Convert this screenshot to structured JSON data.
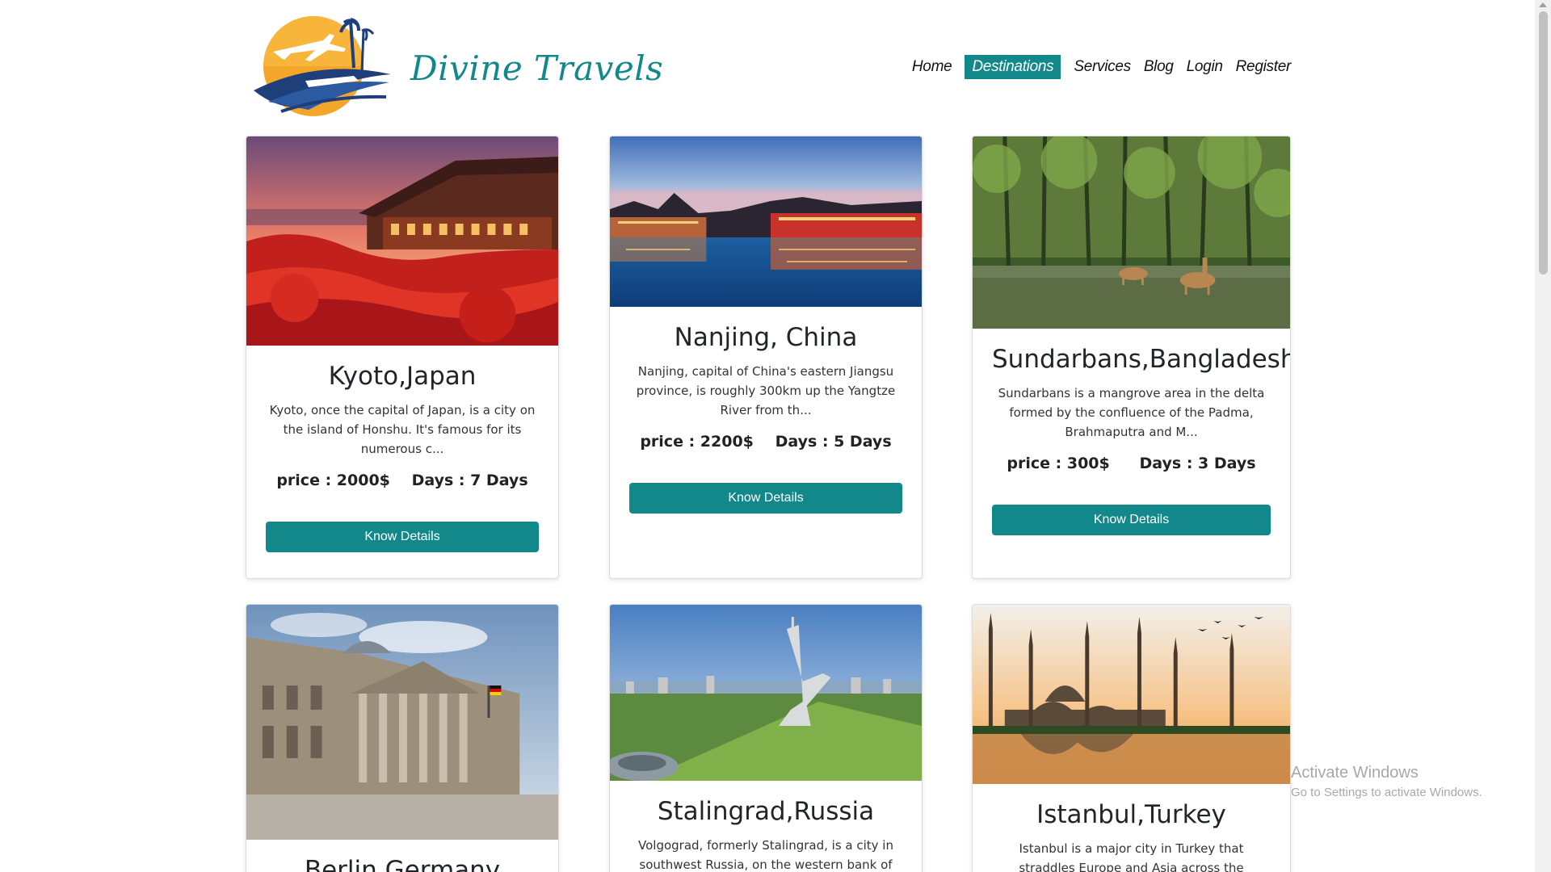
{
  "header": {
    "brand": "Divine Travels",
    "nav": [
      {
        "label": "Home",
        "active": false
      },
      {
        "label": "Destinations",
        "active": true
      },
      {
        "label": "Services",
        "active": false
      },
      {
        "label": "Blog",
        "active": false
      },
      {
        "label": "Login",
        "active": false
      },
      {
        "label": "Register",
        "active": false
      }
    ]
  },
  "destinations": [
    {
      "title": "Kyoto,Japan",
      "description": "Kyoto, once the capital of Japan, is a city on the island of Honshu. It's famous for its numerous c...",
      "price": "price : 2000$",
      "days": "Days : 7 Days",
      "button": "Know Details"
    },
    {
      "title": "Nanjing, China",
      "description": "Nanjing, capital of China's eastern Jiangsu province, is roughly 300km up the Yangtze River from th...",
      "price": "price : 2200$",
      "days": "Days : 5 Days",
      "button": "Know Details"
    },
    {
      "title": "Sundarbans,Bangladesh",
      "description": "Sundarbans is a mangrove area in the delta formed by the confluence of the Padma, Brahmaputra and M...",
      "price": "price : 300$",
      "days": "Days : 3 Days",
      "button": "Know Details"
    },
    {
      "title": "Berlin,Germany"
    },
    {
      "title": "Stalingrad,Russia",
      "description": "Volgograd, formerly Stalingrad, is a city in southwest Russia, on the western bank of the"
    },
    {
      "title": "Istanbul,Turkey",
      "description": "Istanbul is a major city in Turkey that straddles Europe and Asia across the Bosphorus Strait. Its"
    }
  ],
  "watermark": {
    "line1": "Activate Windows",
    "line2": "Go to Settings to activate Windows."
  },
  "colors": {
    "accent": "#13888a",
    "logo_orange": "#f39c1e",
    "logo_navy": "#1f3f7a"
  }
}
